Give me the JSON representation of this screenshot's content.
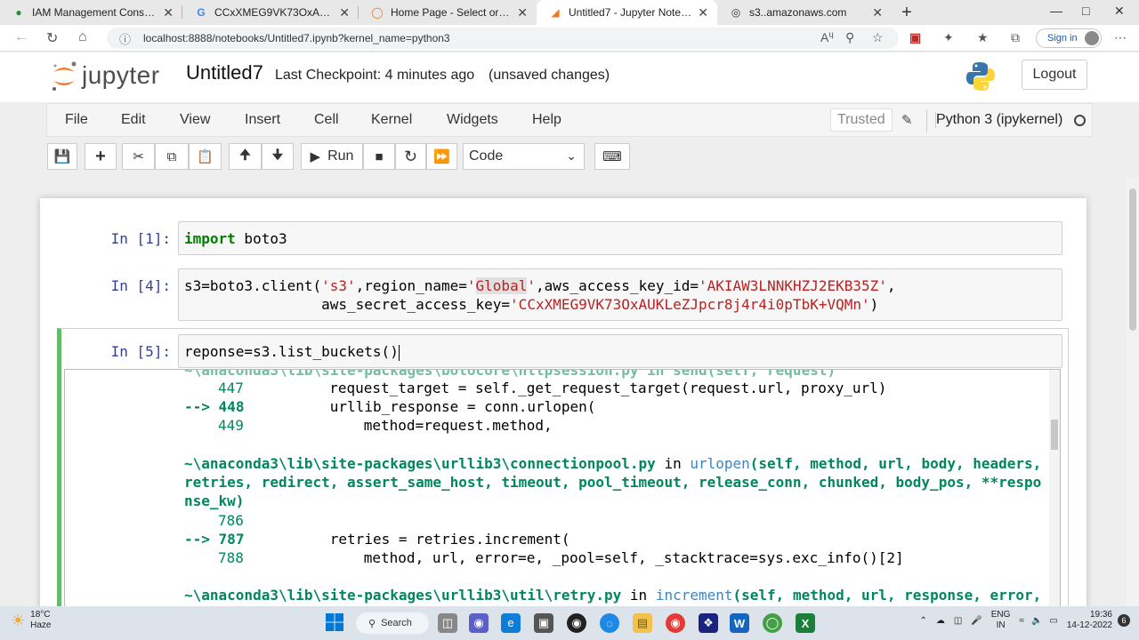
{
  "browser": {
    "tabs": [
      {
        "title": "IAM Management Console",
        "icon": "aws-pin-icon"
      },
      {
        "title": "CCxXMEG9VK73OxAUKLeZJpcr8j4r4i0pTbK+VQMn - Google",
        "icon": "google-icon"
      },
      {
        "title": "Home Page - Select or create a notebook",
        "icon": "jupyter-icon"
      },
      {
        "title": "Untitled7 - Jupyter Notebook",
        "icon": "jupyter-icon"
      },
      {
        "title": "s3..amazonaws.com",
        "icon": "aws-icon"
      }
    ],
    "active_tab": 3,
    "url": "localhost:8888/notebooks/Untitled7.ipynb?kernel_name=python3",
    "signin_label": "Sign in"
  },
  "jupyter": {
    "logo_text": "jupyter",
    "notebook_title": "Untitled7",
    "checkpoint": "Last Checkpoint: 4 minutes ago",
    "unsaved": "(unsaved changes)",
    "logout_label": "Logout",
    "menu": [
      "File",
      "Edit",
      "View",
      "Insert",
      "Cell",
      "Kernel",
      "Widgets",
      "Help"
    ],
    "trusted_label": "Trusted",
    "kernel_label": "Python 3 (ipykernel)",
    "run_label": "Run",
    "cell_type": "Code"
  },
  "cells": [
    {
      "prompt": "In [1]:",
      "kw": "import",
      "rest": " boto3"
    },
    {
      "prompt": "In [4]:",
      "line1_a": "s3=boto3.client(",
      "line1_s1": "'s3'",
      "line1_b": ",region_name=",
      "line1_s2a": "'",
      "line1_s2hl": "Global",
      "line1_s2b": "'",
      "line1_c": ",aws_access_key_id=",
      "line1_s3": "'AKIAW3LNNKHZJ2EKB35Z'",
      "line1_d": ",",
      "line2_a": "aws_secret_access_key=",
      "line2_s": "'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'",
      "line2_b": ")"
    },
    {
      "prompt": "In [5]:",
      "code": "reponse=s3.list_buckets()"
    }
  ],
  "traceback": {
    "partial_top": "~\\anaconda3\\lib\\site-packages\\botocore\\httpsession.py in send(self, request)",
    "block1": [
      {
        "num": "447",
        "code": "request_target = self._get_request_target(request.url, proxy_url)"
      },
      {
        "num": "448",
        "code": "urllib_response = conn.urlopen(",
        "arrow": "-->"
      },
      {
        "num": "449",
        "code": "    method=request.method,"
      }
    ],
    "path2": "~\\anaconda3\\lib\\site-packages\\urllib3\\connectionpool.py",
    "in2": " in ",
    "fn2": "urlopen",
    "args2_l1": "(self, method, url, body, headers,",
    "args2_l2": "retries, redirect, assert_same_host, timeout, pool_timeout, release_conn, chunked, body_pos, **respo",
    "args2_l3": "nse_kw)",
    "block2": [
      {
        "num": "786",
        "code": ""
      },
      {
        "num": "787",
        "code": "retries = retries.increment(",
        "arrow": "-->"
      },
      {
        "num": "788",
        "code": "    method, url, error=e, _pool=self, _stacktrace=sys.exc_info()[2]"
      }
    ],
    "path3": "~\\anaconda3\\lib\\site-packages\\urllib3\\util\\retry.py",
    "in3": " in ",
    "fn3": "increment",
    "args3": "(self, method, url, response, error,"
  },
  "taskbar": {
    "temp": "18°C",
    "weather": "Haze",
    "search_label": "Search",
    "lang1": "ENG",
    "lang2": "IN",
    "time": "19:36",
    "date": "14-12-2022",
    "badge": "6"
  }
}
